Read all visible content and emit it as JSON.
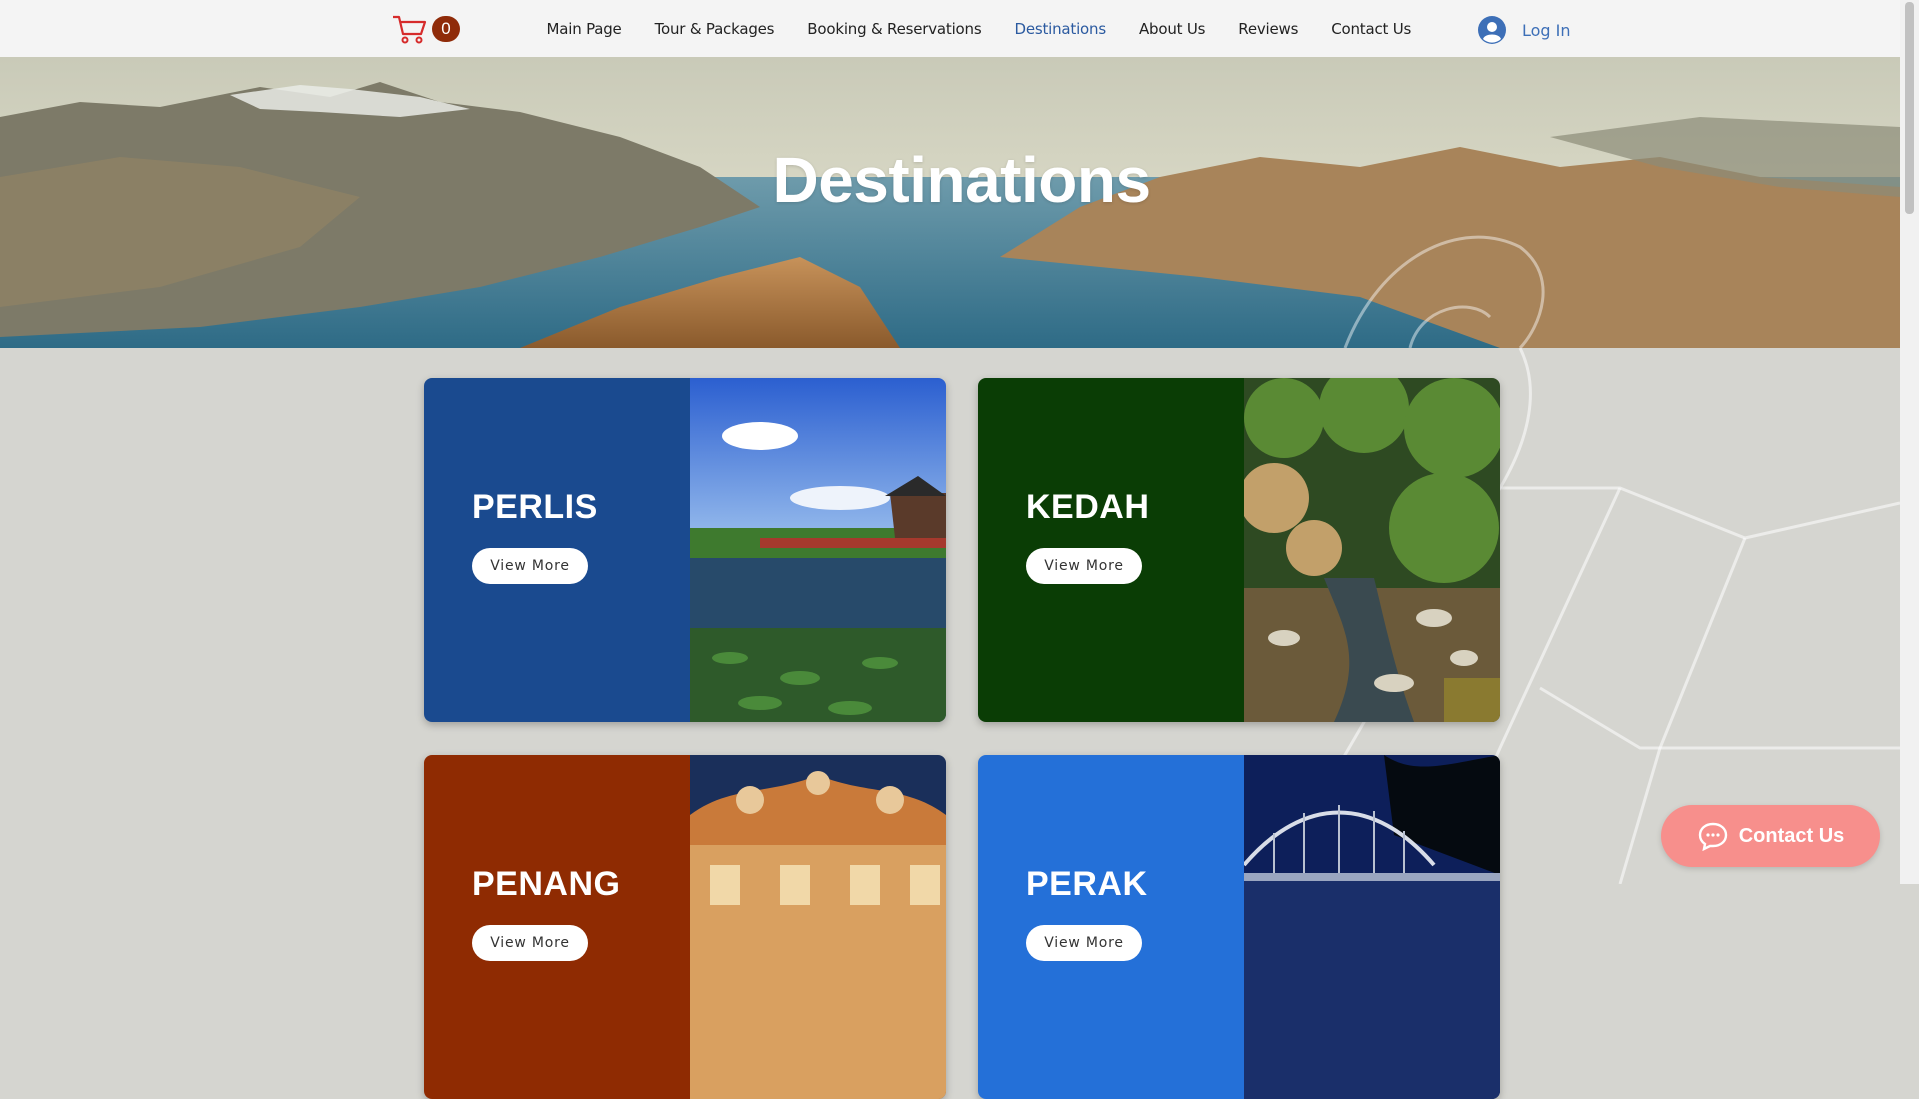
{
  "header": {
    "cart_count": "0",
    "nav": [
      {
        "label": "Main Page"
      },
      {
        "label": "Tour & Packages"
      },
      {
        "label": "Booking & Reservations"
      },
      {
        "label": "Destinations",
        "active": true
      },
      {
        "label": "About Us"
      },
      {
        "label": "Reviews"
      },
      {
        "label": "Contact Us"
      }
    ],
    "login_label": "Log In"
  },
  "hero": {
    "title": "Destinations"
  },
  "cards": [
    {
      "name": "PERLIS",
      "button": "View More",
      "color": "#1a4a8f"
    },
    {
      "name": "KEDAH",
      "button": "View More",
      "color": "#0a3d05"
    },
    {
      "name": "PENANG",
      "button": "View More",
      "color": "#8f2b02"
    },
    {
      "name": "PERAK",
      "button": "View More",
      "color": "#2470d8"
    }
  ],
  "contact_fab": {
    "label": "Contact Us"
  },
  "colors": {
    "accent": "#3d6fb7",
    "cart": "#d62b2b",
    "badge": "#8f2b09",
    "fab": "#f78f8c"
  }
}
